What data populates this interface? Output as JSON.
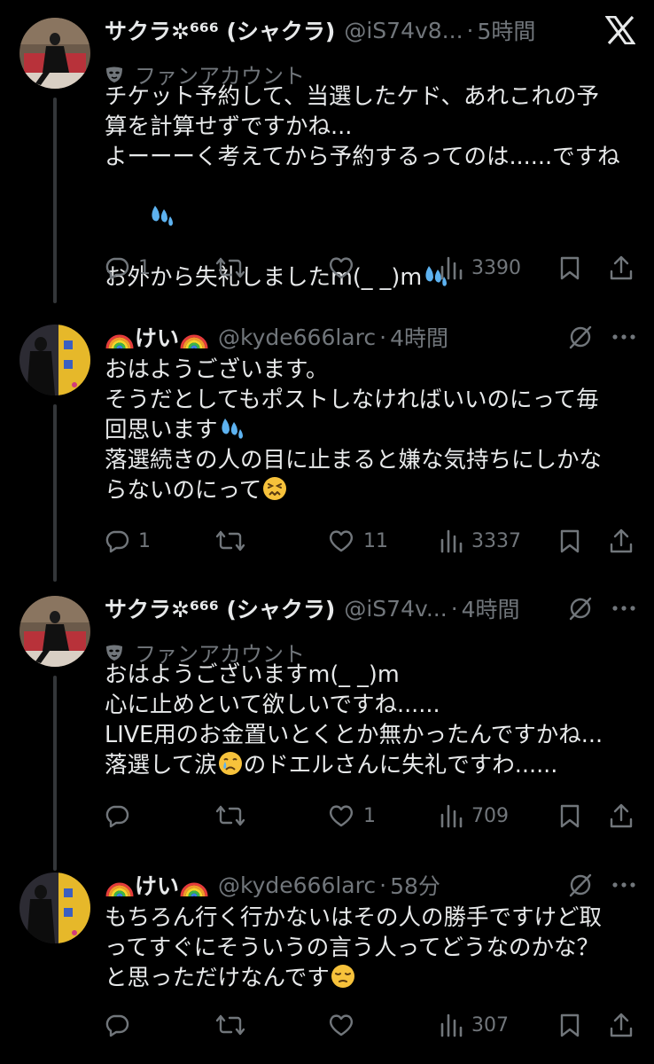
{
  "tweets": [
    {
      "name": "サクラ✲⁶⁶⁶ (シャクラ)",
      "handle": "@iS74v8...",
      "time": "5時間",
      "badge": "ファンアカウント",
      "lines": [
        "チケット予約して、当選したケド、あれこれの予",
        "算を計算せずですかね...",
        "よーーーく考えてから予約するってのは......ですね",
        "",
        "お外から失礼しましたm(_ _)m"
      ],
      "replies": "1",
      "retweets": "",
      "likes": "",
      "views": "3390"
    },
    {
      "name": "けい",
      "handle": "@kyde666larc",
      "time": "4時間",
      "lines": [
        "おはようございます。",
        "そうだとしてもポストしなければいいのにって毎",
        "回思います",
        "落選続きの人の目に止まると嫌な気持ちにしかな",
        "らないのにって"
      ],
      "replies": "1",
      "retweets": "",
      "likes": "11",
      "views": "3337"
    },
    {
      "name": "サクラ✲⁶⁶⁶ (シャクラ)",
      "handle": "@iS74v...",
      "time": "4時間",
      "badge": "ファンアカウント",
      "lines": [
        "おはようございますm(_ _)m",
        "心に止めといて欲しいですね......",
        "LIVE用のお金置いとくとか無かったんですかね...",
        "落選して涙",
        ""
      ],
      "line4_suffix": "のドエルさんに失礼ですわ......",
      "replies": "",
      "retweets": "",
      "likes": "1",
      "views": "709"
    },
    {
      "name": "けい",
      "handle": "@kyde666larc",
      "time": "58分",
      "lines": [
        "もちろん行く行かないはその人の勝手ですけど取",
        "ってすぐにそういうの言う人ってどうなのかな？",
        "と思っただけなんです"
      ],
      "replies": "",
      "retweets": "",
      "likes": "",
      "views": "307"
    }
  ],
  "sep": "·",
  "x_logo": "X",
  "colors": {
    "bg": "#000000",
    "text": "#e7e9ea",
    "muted": "#71767b",
    "line": "#333639"
  },
  "icons": [
    "reply-icon",
    "retweet-icon",
    "like-icon",
    "views-icon",
    "bookmark-icon",
    "share-icon",
    "grok-icon",
    "more-icon",
    "x-logo-icon",
    "mask-icon"
  ]
}
